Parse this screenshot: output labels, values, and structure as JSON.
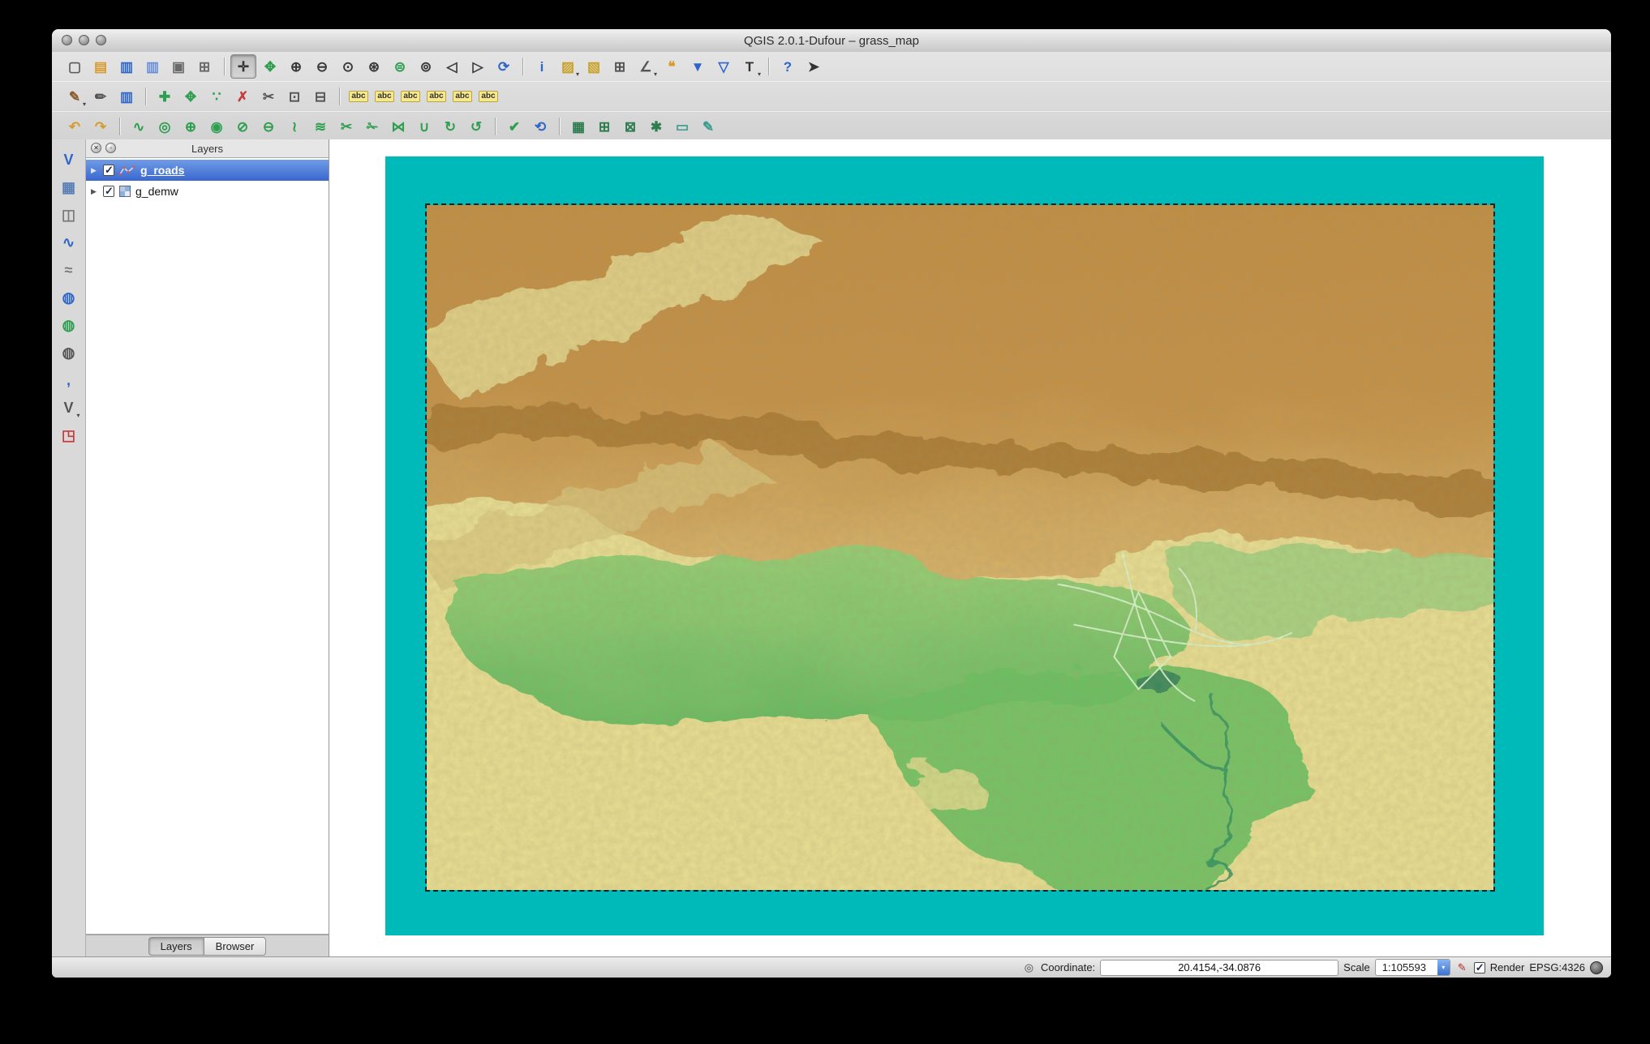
{
  "window": {
    "title": "QGIS 2.0.1-Dufour – grass_map"
  },
  "toolbars": {
    "row1": [
      {
        "name": "new-project-icon",
        "glyph": "▢",
        "color": "#5a5a5a"
      },
      {
        "name": "open-project-icon",
        "glyph": "▤",
        "color": "#d79b2f"
      },
      {
        "name": "save-project-icon",
        "glyph": "▥",
        "color": "#2f66c8"
      },
      {
        "name": "save-project-as-icon",
        "glyph": "▥",
        "color": "#6a8fd8"
      },
      {
        "name": "new-print-composer-icon",
        "glyph": "▣",
        "color": "#6a6a6a"
      },
      {
        "name": "composer-manager-icon",
        "glyph": "⊞",
        "color": "#6a6a6a"
      },
      {
        "name": "pan-map-icon",
        "glyph": "✛",
        "color": "#333333",
        "active": true,
        "sep": true
      },
      {
        "name": "pan-to-selection-icon",
        "glyph": "✥",
        "color": "#2e9e4f"
      },
      {
        "name": "zoom-in-icon",
        "glyph": "⊕",
        "color": "#3a3a3a"
      },
      {
        "name": "zoom-out-icon",
        "glyph": "⊖",
        "color": "#3a3a3a"
      },
      {
        "name": "zoom-actual-icon",
        "glyph": "⊙",
        "color": "#3a3a3a"
      },
      {
        "name": "zoom-full-icon",
        "glyph": "⊛",
        "color": "#3a3a3a"
      },
      {
        "name": "zoom-to-selection-icon",
        "glyph": "⊜",
        "color": "#2e9e4f"
      },
      {
        "name": "zoom-to-layer-icon",
        "glyph": "⊚",
        "color": "#3a3a3a"
      },
      {
        "name": "zoom-last-icon",
        "glyph": "◁",
        "color": "#3a3a3a"
      },
      {
        "name": "zoom-next-icon",
        "glyph": "▷",
        "color": "#3a3a3a"
      },
      {
        "name": "refresh-map-icon",
        "glyph": "⟳",
        "color": "#2f66c8"
      },
      {
        "name": "identify-features-icon",
        "glyph": "i",
        "color": "#2f66c8",
        "sep": true
      },
      {
        "name": "select-features-icon",
        "glyph": "▨",
        "color": "#c9a227",
        "dd": "▾"
      },
      {
        "name": "deselect-features-icon",
        "glyph": "▧",
        "color": "#c9a227"
      },
      {
        "name": "open-attribute-table-icon",
        "glyph": "⊞",
        "color": "#555555"
      },
      {
        "name": "measure-icon",
        "glyph": "∠",
        "color": "#555555",
        "dd": "▾"
      },
      {
        "name": "map-tips-icon",
        "glyph": "❝",
        "color": "#d79b2f"
      },
      {
        "name": "new-bookmark-icon",
        "glyph": "▼",
        "color": "#2f66c8"
      },
      {
        "name": "show-bookmarks-icon",
        "glyph": "▽",
        "color": "#2f66c8"
      },
      {
        "name": "text-annotation-icon",
        "glyph": "T",
        "color": "#333333",
        "dd": "▾"
      },
      {
        "name": "help-contents-icon",
        "glyph": "?",
        "color": "#2f66c8",
        "sep": true
      },
      {
        "name": "whats-this-icon",
        "glyph": "➤",
        "color": "#333333"
      }
    ],
    "row2": [
      {
        "name": "current-edits-icon",
        "glyph": "✎",
        "color": "#8a5a2a",
        "dd": "▾"
      },
      {
        "name": "toggle-editing-icon",
        "glyph": "✏",
        "color": "#555555"
      },
      {
        "name": "save-layer-edits-icon",
        "glyph": "▥",
        "color": "#2f66c8"
      },
      {
        "name": "add-feature-icon",
        "glyph": "✚",
        "color": "#2e9e4f",
        "sep": true
      },
      {
        "name": "move-feature-icon",
        "glyph": "✥",
        "color": "#2e9e4f"
      },
      {
        "name": "node-tool-icon",
        "glyph": "∵",
        "color": "#2e9e4f"
      },
      {
        "name": "delete-selected-icon",
        "glyph": "✗",
        "color": "#c43c3c"
      },
      {
        "name": "cut-features-icon",
        "glyph": "✂",
        "color": "#555555"
      },
      {
        "name": "copy-features-icon",
        "glyph": "⊡",
        "color": "#555555"
      },
      {
        "name": "paste-features-icon",
        "glyph": "⊟",
        "color": "#555555"
      },
      {
        "name": "layer-labeling-icon",
        "glyph": "abc",
        "color": "#333333",
        "abc": true,
        "sep": true
      },
      {
        "name": "pin-labels-icon",
        "glyph": "abc",
        "color": "#333333",
        "abc": true
      },
      {
        "name": "highlight-labels-icon",
        "glyph": "abc",
        "color": "#333333",
        "abc": true
      },
      {
        "name": "move-label-icon",
        "glyph": "abc",
        "color": "#333333",
        "abc": true
      },
      {
        "name": "rotate-label-icon",
        "glyph": "abc",
        "color": "#333333",
        "abc": true
      },
      {
        "name": "change-label-icon",
        "glyph": "abc",
        "color": "#333333",
        "abc": true
      }
    ],
    "row3": [
      {
        "name": "undo-icon",
        "glyph": "↶",
        "color": "#d79b2f"
      },
      {
        "name": "redo-icon",
        "glyph": "↷",
        "color": "#d79b2f"
      },
      {
        "name": "simplify-feature-icon",
        "glyph": "∿",
        "color": "#2e9e4f",
        "sep": true
      },
      {
        "name": "add-ring-icon",
        "glyph": "◎",
        "color": "#2e9e4f"
      },
      {
        "name": "add-part-icon",
        "glyph": "⊕",
        "color": "#2e9e4f"
      },
      {
        "name": "fill-ring-icon",
        "glyph": "◉",
        "color": "#2e9e4f"
      },
      {
        "name": "delete-ring-icon",
        "glyph": "⊘",
        "color": "#2e9e4f"
      },
      {
        "name": "delete-part-icon",
        "glyph": "⊖",
        "color": "#2e9e4f"
      },
      {
        "name": "reshape-features-icon",
        "glyph": "≀",
        "color": "#2e9e4f"
      },
      {
        "name": "offset-curve-icon",
        "glyph": "≋",
        "color": "#2e9e4f"
      },
      {
        "name": "split-features-icon",
        "glyph": "✂",
        "color": "#2e9e4f"
      },
      {
        "name": "split-parts-icon",
        "glyph": "✁",
        "color": "#2e9e4f"
      },
      {
        "name": "merge-features-icon",
        "glyph": "⋈",
        "color": "#2e9e4f"
      },
      {
        "name": "merge-attributes-icon",
        "glyph": "∪",
        "color": "#2e9e4f"
      },
      {
        "name": "rotate-feature-icon",
        "glyph": "↻",
        "color": "#2e9e4f"
      },
      {
        "name": "rotate-point-symbols-icon",
        "glyph": "↺",
        "color": "#2e9e4f"
      },
      {
        "name": "check-geometry-icon",
        "glyph": "✔",
        "color": "#2e9e4f",
        "sep": true
      },
      {
        "name": "reload-icon",
        "glyph": "⟲",
        "color": "#2f66c8"
      },
      {
        "name": "grass-open-mapset-icon",
        "glyph": "▦",
        "color": "#2e7d4f",
        "sep": true
      },
      {
        "name": "grass-new-mapset-icon",
        "glyph": "⊞",
        "color": "#2e7d4f"
      },
      {
        "name": "grass-close-mapset-icon",
        "glyph": "⊠",
        "color": "#2e7d4f"
      },
      {
        "name": "grass-tools-icon",
        "glyph": "✱",
        "color": "#2e7d4f"
      },
      {
        "name": "grass-display-region-icon",
        "glyph": "▭",
        "color": "#3a9b8f"
      },
      {
        "name": "grass-edit-region-icon",
        "glyph": "✎",
        "color": "#3a9b8f"
      }
    ],
    "side": [
      {
        "name": "add-vector-layer-icon",
        "glyph": "V",
        "color": "#2f66c8"
      },
      {
        "name": "add-raster-layer-icon",
        "glyph": "▦",
        "color": "#5a7fb5"
      },
      {
        "name": "add-postgis-layer-icon",
        "glyph": "◫",
        "color": "#7a7a7a"
      },
      {
        "name": "add-spatialite-layer-icon",
        "glyph": "∿",
        "color": "#2f66c8"
      },
      {
        "name": "add-mssql-layer-icon",
        "glyph": "≈",
        "color": "#7a7a7a"
      },
      {
        "name": "add-wms-layer-icon",
        "glyph": "◍",
        "color": "#2f66c8"
      },
      {
        "name": "add-wcs-layer-icon",
        "glyph": "◍",
        "color": "#2e9e4f"
      },
      {
        "name": "add-wfs-layer-icon",
        "glyph": "◍",
        "color": "#555555"
      },
      {
        "name": "add-delimited-text-layer-icon",
        "glyph": ",",
        "color": "#2f66c8"
      },
      {
        "name": "new-shapefile-layer-icon",
        "glyph": "V",
        "color": "#555555",
        "dd": "▾"
      },
      {
        "name": "add-oracle-georaster-layer-icon",
        "glyph": "◳",
        "color": "#c43c3c"
      }
    ]
  },
  "layers_panel": {
    "title": "Layers",
    "close_glyph": "✕",
    "float_glyph": "▫",
    "expander_glyph": "▶",
    "items": [
      {
        "label": "g_roads",
        "checked": true,
        "selected": true,
        "kind": "vector"
      },
      {
        "label": "g_demw",
        "checked": true,
        "selected": false,
        "kind": "raster"
      }
    ],
    "tabs": [
      {
        "label": "Layers",
        "active": true
      },
      {
        "label": "Browser",
        "active": false
      }
    ]
  },
  "map": {
    "canvas_color": "#ffffff",
    "frame_color": "#00b9b9",
    "region_border": "dashed",
    "terrain_palette": [
      "#c08c42",
      "#a5742f",
      "#e8de92",
      "#93cf74",
      "#5fba5e",
      "#2f9160"
    ]
  },
  "status_bar": {
    "toggle_icon_glyph": "◎",
    "coordinate_label": "Coordinate:",
    "coordinate_value": "20.4154,-34.0876",
    "scale_label": "Scale",
    "scale_value": "1:105593",
    "combo_arrow_glyph": "▾",
    "stop_icon_glyph": "✎",
    "render_label": "Render",
    "render_checked": true,
    "crs_label": "EPSG:4326"
  }
}
